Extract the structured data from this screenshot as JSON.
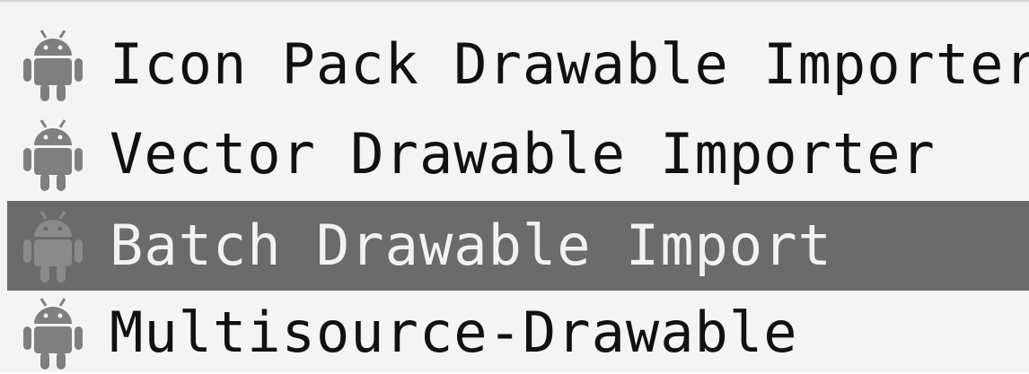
{
  "menu": {
    "items": [
      {
        "label": "Icon Pack Drawable Importer",
        "icon": "android-icon",
        "selected": false
      },
      {
        "label": "Vector Drawable Importer",
        "icon": "android-icon",
        "selected": false
      },
      {
        "label": "Batch Drawable Import",
        "icon": "android-icon",
        "selected": true
      },
      {
        "label": "Multisource-Drawable",
        "icon": "android-icon",
        "selected": false
      }
    ]
  },
  "colors": {
    "icon": "#7f7f7f",
    "icon_selected": "#8a8a8a",
    "selected_background": "#6b6b6b",
    "text": "#111111",
    "text_selected": "#f2f2f2"
  }
}
